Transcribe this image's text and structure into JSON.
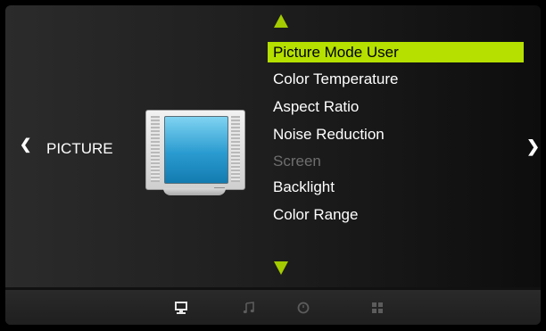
{
  "menu": {
    "section_title": "PICTURE",
    "items": [
      {
        "label": "Picture Mode User",
        "state": "selected"
      },
      {
        "label": "Color Temperature",
        "state": "normal"
      },
      {
        "label": "Aspect Ratio",
        "state": "normal"
      },
      {
        "label": "Noise Reduction",
        "state": "normal"
      },
      {
        "label": "Screen",
        "state": "disabled"
      },
      {
        "label": "Backlight",
        "state": "normal"
      },
      {
        "label": "Color Range",
        "state": "normal"
      }
    ]
  },
  "bottom_tabs": [
    {
      "icon": "monitor-icon",
      "active": true
    },
    {
      "icon": "music-note-icon",
      "active": false
    },
    {
      "icon": "clock-icon",
      "active": false
    },
    {
      "icon": "grid-icon",
      "active": false
    }
  ],
  "colors": {
    "highlight": "#b5e000",
    "arrow": "#a4cc00",
    "disabled_text": "#6e6e6e"
  }
}
